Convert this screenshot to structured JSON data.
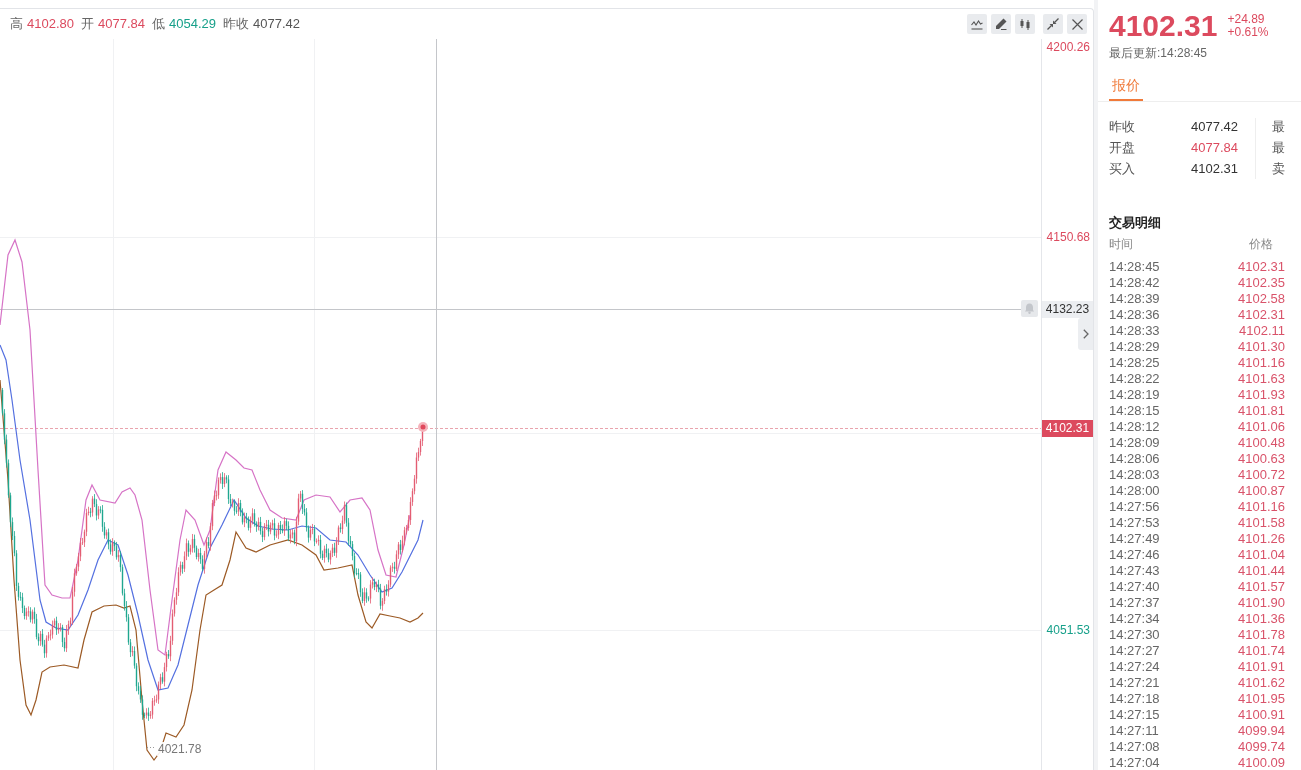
{
  "chart_header": {
    "stats": [
      {
        "label": "高",
        "value": "4102.80",
        "color": "#dc4a5e"
      },
      {
        "label": "开",
        "value": "4077.84",
        "color": "#dc4a5e"
      },
      {
        "label": "低",
        "value": "4054.29",
        "color": "#17a08a"
      },
      {
        "label": "昨收",
        "value": "4077.42",
        "color": "#555555"
      }
    ]
  },
  "price_axis": {
    "labels": [
      {
        "text": "4200.26",
        "color": "#dc4a5e"
      },
      {
        "text": "4150.68",
        "color": "#dc4a5e"
      },
      {
        "text": "4051.53",
        "color": "#17a08a"
      }
    ],
    "crosshair_price": "4132.23",
    "last_price": "4102.31"
  },
  "chart": {
    "low_label": "4021.78"
  },
  "quote": {
    "price": "4102.31",
    "change": "+24.89",
    "change_percent": "+0.61%",
    "updated": "最后更新:14:28:45",
    "tabs": [
      {
        "label": "报价",
        "selected": true
      }
    ],
    "fields": [
      {
        "label": "昨收",
        "value": "4077.42",
        "color": "#333333"
      },
      {
        "label": "开盘",
        "value": "4077.84",
        "color": "#dc4a5e"
      },
      {
        "label": "买入",
        "value": "4102.31",
        "color": "#333333"
      }
    ],
    "fields_column_2": [
      {
        "label": "最"
      },
      {
        "label": "最"
      },
      {
        "label": "卖"
      }
    ]
  },
  "trades": {
    "title": "交易明细",
    "columns": [
      "时间",
      "价格"
    ],
    "rows": [
      {
        "time": "14:28:45",
        "price": "4102.31"
      },
      {
        "time": "14:28:42",
        "price": "4102.35"
      },
      {
        "time": "14:28:39",
        "price": "4102.58"
      },
      {
        "time": "14:28:36",
        "price": "4102.31"
      },
      {
        "time": "14:28:33",
        "price": "4102.11"
      },
      {
        "time": "14:28:29",
        "price": "4101.30"
      },
      {
        "time": "14:28:25",
        "price": "4101.16"
      },
      {
        "time": "14:28:22",
        "price": "4101.63"
      },
      {
        "time": "14:28:19",
        "price": "4101.93"
      },
      {
        "time": "14:28:15",
        "price": "4101.81"
      },
      {
        "time": "14:28:12",
        "price": "4101.06"
      },
      {
        "time": "14:28:09",
        "price": "4100.48"
      },
      {
        "time": "14:28:06",
        "price": "4100.63"
      },
      {
        "time": "14:28:03",
        "price": "4100.72"
      },
      {
        "time": "14:28:00",
        "price": "4100.87"
      },
      {
        "time": "14:27:56",
        "price": "4101.16"
      },
      {
        "time": "14:27:53",
        "price": "4101.58"
      },
      {
        "time": "14:27:49",
        "price": "4101.26"
      },
      {
        "time": "14:27:46",
        "price": "4101.04"
      },
      {
        "time": "14:27:43",
        "price": "4101.44"
      },
      {
        "time": "14:27:40",
        "price": "4101.57"
      },
      {
        "time": "14:27:37",
        "price": "4101.90"
      },
      {
        "time": "14:27:34",
        "price": "4101.36"
      },
      {
        "time": "14:27:30",
        "price": "4101.78"
      },
      {
        "time": "14:27:27",
        "price": "4101.74"
      },
      {
        "time": "14:27:24",
        "price": "4101.91"
      },
      {
        "time": "14:27:21",
        "price": "4101.62"
      },
      {
        "time": "14:27:18",
        "price": "4101.95"
      },
      {
        "time": "14:27:15",
        "price": "4100.91"
      },
      {
        "time": "14:27:11",
        "price": "4099.94"
      },
      {
        "time": "14:27:08",
        "price": "4099.74"
      },
      {
        "time": "14:27:04",
        "price": "4100.09"
      }
    ]
  }
}
